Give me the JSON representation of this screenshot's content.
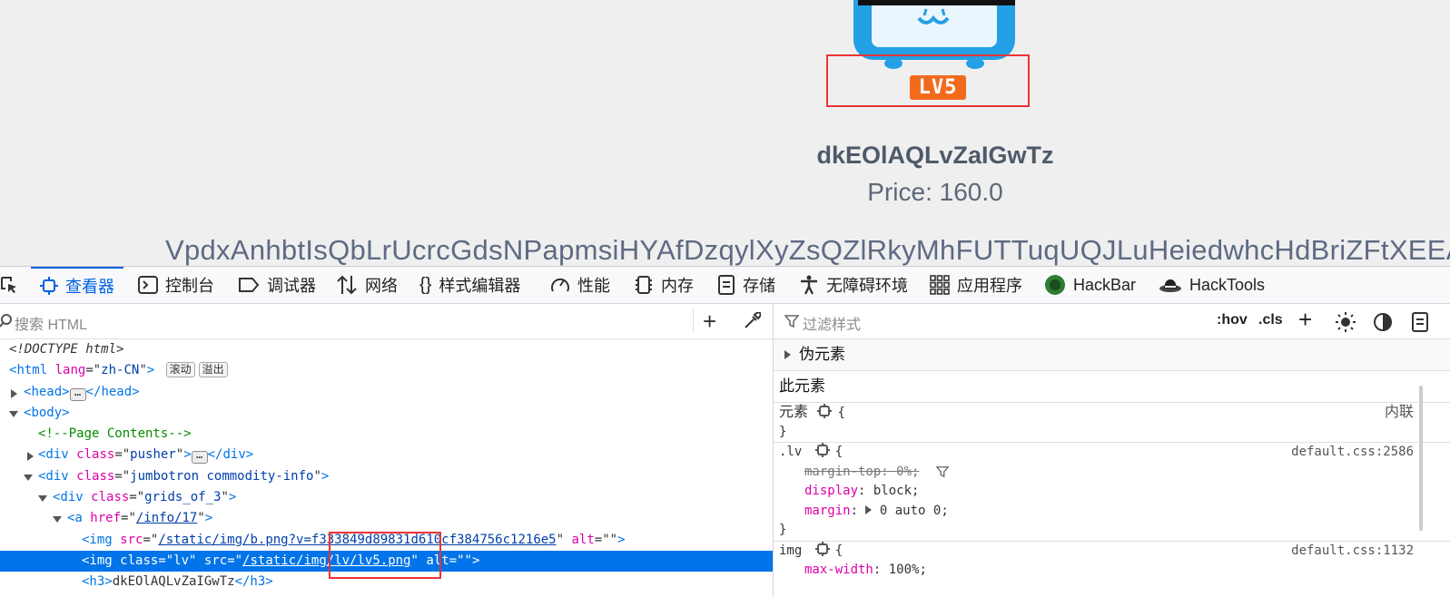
{
  "preview": {
    "lv_label": "LV5",
    "title": "dkEOlAQLvZaIGwTz",
    "price": "Price: 160.0",
    "description": "VpdxAnhbtIsQbLrUcrcGdsNPapmsiHYAfDzqylXyZsQZlRkyMhFUTTuqUQJLuHeiedwhcHdBriZFtXEEAV"
  },
  "toolbar": {
    "tabs": [
      {
        "label": "查看器",
        "icon": "inspector-icon",
        "active": true
      },
      {
        "label": "控制台",
        "icon": "console-icon"
      },
      {
        "label": "调试器",
        "icon": "debugger-icon"
      },
      {
        "label": "网络",
        "icon": "network-icon"
      },
      {
        "label": "样式编辑器",
        "icon": "style-editor-icon"
      },
      {
        "label": "性能",
        "icon": "performance-icon"
      },
      {
        "label": "内存",
        "icon": "memory-icon"
      },
      {
        "label": "存储",
        "icon": "storage-icon"
      },
      {
        "label": "无障碍环境",
        "icon": "accessibility-icon"
      },
      {
        "label": "应用程序",
        "icon": "application-icon"
      },
      {
        "label": "HackBar",
        "icon": "hackbar-icon"
      },
      {
        "label": "HackTools",
        "icon": "hacktools-icon"
      }
    ]
  },
  "inspector": {
    "search_placeholder": "搜索 HTML",
    "tree": {
      "doctype": "<!DOCTYPE html>",
      "html_tag": "html",
      "html_lang_attr": "lang",
      "html_lang_val": "zh-CN",
      "badge_scroll": "滚动",
      "badge_overflow": "溢出",
      "head_tag": "head",
      "body_tag": "body",
      "comment": "<!--Page Contents-->",
      "div_pusher_class": "pusher",
      "div_jumbotron_class": "jumbotron commodity-info",
      "div_grids_class": "grids_of_3",
      "a_href": "/info/17",
      "img1_src": "/static/img/b.png?v=f333849d89831d610cf384756c1216e5",
      "img2_class": "lv",
      "img2_src": "/static/img/lv/lv5.png",
      "h3_text": "dkEOlAQLvZaIGwTz"
    }
  },
  "rules": {
    "filter_placeholder": "过滤样式",
    "hov_button": ":hov",
    "cls_button": ".cls",
    "pseudo_section": "伪元素",
    "this_element_section": "此元素",
    "element_rule": {
      "selector": "元素",
      "source": "内联"
    },
    "lv_rule": {
      "selector": ".lv",
      "source": "default.css:2586",
      "props": [
        {
          "name": "margin-top",
          "value": "0%",
          "overridden": true
        },
        {
          "name": "display",
          "value": "block"
        },
        {
          "name": "margin",
          "value": "0 auto 0"
        }
      ]
    },
    "img_rule": {
      "selector": "img",
      "source": "default.css:1132",
      "props": [
        {
          "name": "max-width",
          "value": "100%"
        }
      ]
    }
  }
}
